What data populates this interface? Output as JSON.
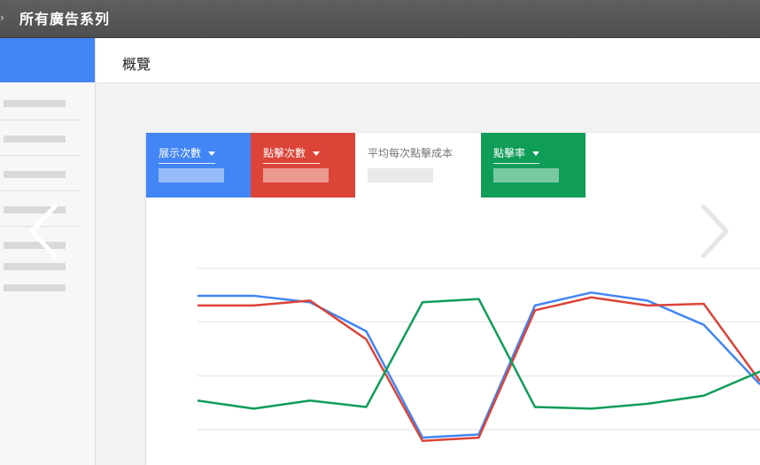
{
  "topbar": {
    "title": "所有廣告系列"
  },
  "header": {
    "page_title": "概覽"
  },
  "metric_tabs": [
    {
      "label": "展示次數",
      "color": "#4285f4",
      "has_dropdown": true
    },
    {
      "label": "點擊次數",
      "color": "#db4437",
      "has_dropdown": true
    },
    {
      "label": "平均每次點擊成本",
      "color": "#ffffff",
      "has_dropdown": false
    },
    {
      "label": "點擊率",
      "color": "#0f9d58",
      "has_dropdown": true
    }
  ],
  "icons": {
    "carousel_prev": "chevron-left-icon",
    "carousel_next": "chevron-right-icon",
    "tab_dropdown": "caret-down-icon"
  },
  "chart_data": {
    "type": "line",
    "grid": true,
    "x": [
      1,
      2,
      3,
      4,
      5,
      6,
      7,
      8,
      9,
      10,
      11
    ],
    "ylim": [
      0,
      100
    ],
    "series": [
      {
        "color": "#4285f4",
        "values": [
          83,
          83,
          79,
          61,
          -5,
          -3,
          77,
          85,
          80,
          65,
          28
        ]
      },
      {
        "color": "#db4437",
        "values": [
          77,
          77,
          80,
          56,
          -7,
          -5,
          74,
          82,
          77,
          78,
          30
        ]
      },
      {
        "color": "#0f9d58",
        "values": [
          18,
          13,
          18,
          14,
          79,
          81,
          14,
          13,
          16,
          21,
          36
        ]
      }
    ]
  }
}
